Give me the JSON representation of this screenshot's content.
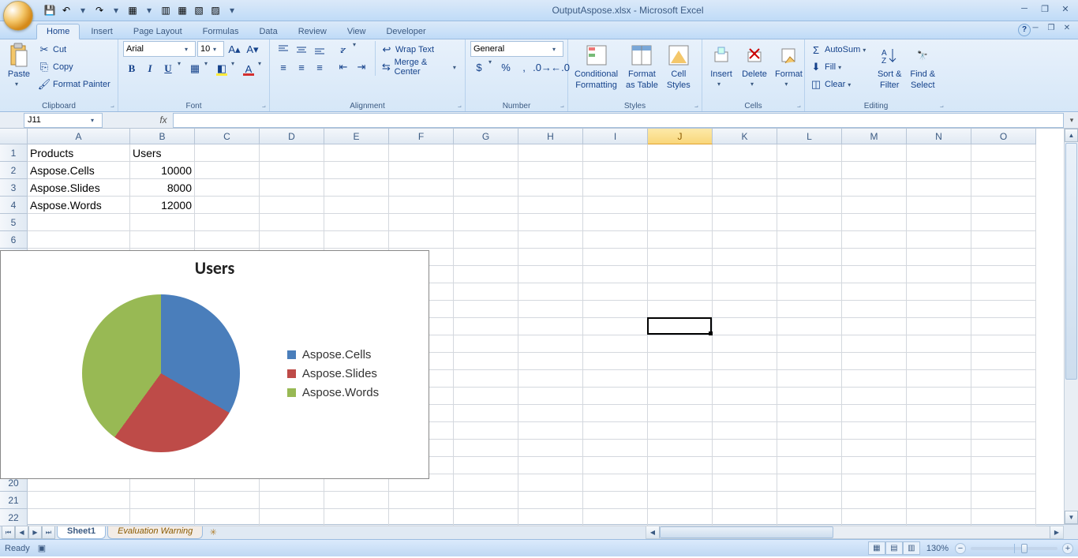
{
  "title": "OutputAspose.xlsx - Microsoft Excel",
  "tabs": [
    "Home",
    "Insert",
    "Page Layout",
    "Formulas",
    "Data",
    "Review",
    "View",
    "Developer"
  ],
  "active_tab": "Home",
  "ribbon": {
    "clipboard": {
      "paste": "Paste",
      "cut": "Cut",
      "copy": "Copy",
      "fmtpaint": "Format Painter",
      "label": "Clipboard"
    },
    "font": {
      "name": "Arial",
      "size": "10",
      "label": "Font"
    },
    "alignment": {
      "wrap": "Wrap Text",
      "merge": "Merge & Center",
      "label": "Alignment"
    },
    "number": {
      "fmt": "General",
      "label": "Number"
    },
    "styles": {
      "cond": "Conditional",
      "cond2": "Formatting",
      "fmt": "Format",
      "fmt2": "as Table",
      "cell": "Cell",
      "cell2": "Styles",
      "label": "Styles"
    },
    "cells": {
      "ins": "Insert",
      "del": "Delete",
      "fmt": "Format",
      "label": "Cells"
    },
    "editing": {
      "sum": "AutoSum",
      "fill": "Fill",
      "clear": "Clear",
      "sort": "Sort &",
      "sort2": "Filter",
      "find": "Find &",
      "find2": "Select",
      "label": "Editing"
    }
  },
  "namebox": "J11",
  "columns": [
    "A",
    "B",
    "C",
    "D",
    "E",
    "F",
    "G",
    "H",
    "I",
    "J",
    "K",
    "L",
    "M",
    "N",
    "O"
  ],
  "selected_col": "J",
  "selected_row": 11,
  "rows": 22,
  "cells": {
    "A1": "Products",
    "B1": "Users",
    "A2": "Aspose.Cells",
    "B2": "10000",
    "A3": "Aspose.Slides",
    "B3": "8000",
    "A4": "Aspose.Words",
    "B4": "12000"
  },
  "chart_data": {
    "type": "pie",
    "title": "Users",
    "categories": [
      "Aspose.Cells",
      "Aspose.Slides",
      "Aspose.Words"
    ],
    "values": [
      10000,
      8000,
      12000
    ],
    "colors": [
      "#4a7ebb",
      "#be4b48",
      "#98b954"
    ]
  },
  "sheets": {
    "s1": "Sheet1",
    "eval": "Evaluation Warning"
  },
  "status": {
    "ready": "Ready",
    "zoom": "130%"
  }
}
